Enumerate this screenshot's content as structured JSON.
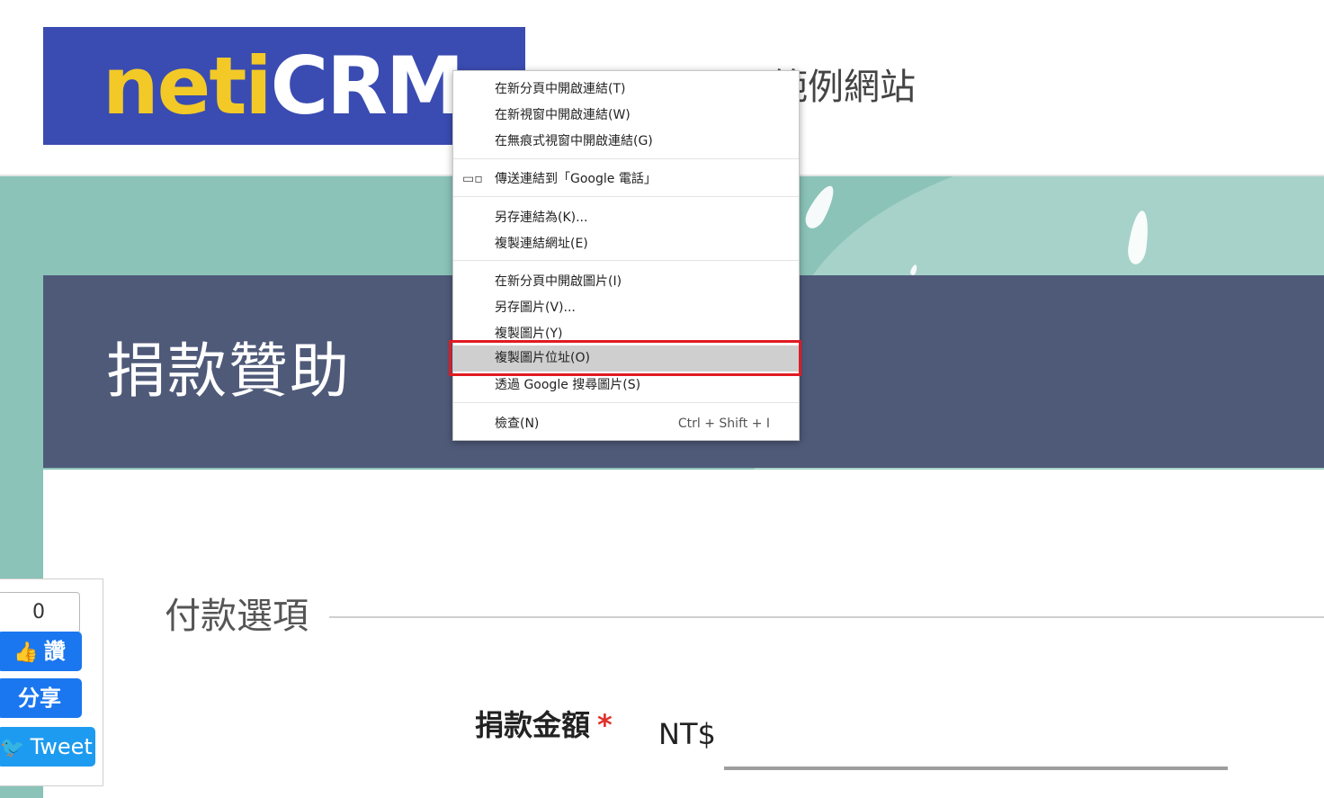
{
  "header": {
    "logo": {
      "part1": "neti",
      "part2": "CRM"
    },
    "site_title": "範例網站"
  },
  "banner": {
    "title": "捐款贊助"
  },
  "form": {
    "section_title": "付款選項",
    "amount_label": "捐款金額",
    "required_mark": "*",
    "currency_prefix": "NT$"
  },
  "social": {
    "like_count": "0",
    "like_label": "讚",
    "share_label": "分享",
    "tweet_label": "Tweet"
  },
  "context_menu": {
    "items": [
      {
        "label": "在新分頁中開啟連結(T)"
      },
      {
        "label": "在新視窗中開啟連結(W)"
      },
      {
        "label": "在無痕式視窗中開啟連結(G)"
      },
      {
        "label": "傳送連結到「Google 電話」",
        "icon": "devices-icon"
      },
      {
        "label": "另存連結為(K)..."
      },
      {
        "label": "複製連結網址(E)"
      },
      {
        "label": "在新分頁中開啟圖片(I)"
      },
      {
        "label": "另存圖片(V)..."
      },
      {
        "label": "複製圖片(Y)"
      },
      {
        "label": "複製圖片位址(O)",
        "highlighted": true
      },
      {
        "label": "透過 Google 搜尋圖片(S)"
      },
      {
        "label": "檢查(N)",
        "shortcut": "Ctrl + Shift + I"
      }
    ]
  },
  "colors": {
    "logo_bg": "#3a4cb1",
    "logo_yellow": "#f2c927",
    "teal_bg": "#8bc3b8",
    "banner_bg": "#4f5a79",
    "facebook_blue": "#1b77ef",
    "twitter_blue": "#1d9bf0",
    "highlight_border": "#e01a22"
  }
}
